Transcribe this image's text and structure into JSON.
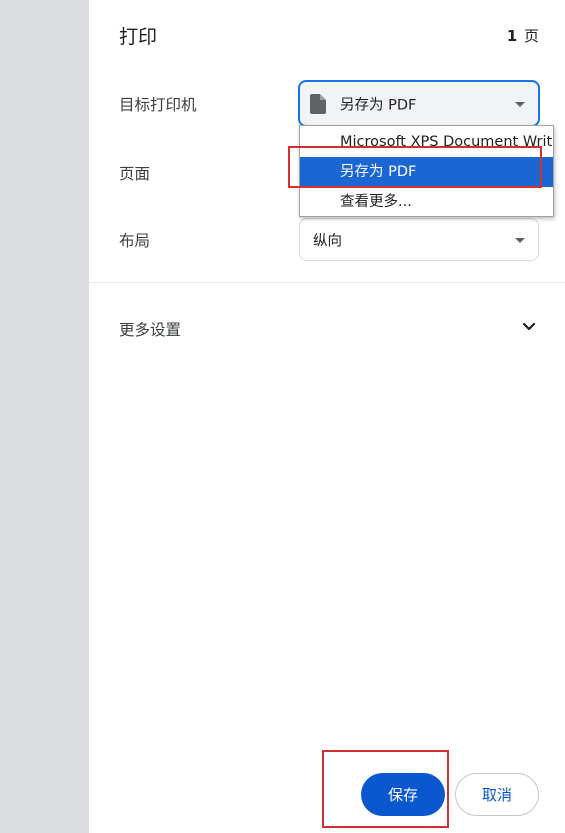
{
  "header": {
    "title": "打印",
    "page_count": "1",
    "page_unit": "页"
  },
  "rows": {
    "destination_label": "目标打印机",
    "destination_value": "另存为 PDF",
    "pages_label": "页面",
    "layout_label": "布局",
    "layout_value": "纵向"
  },
  "more_settings": {
    "label": "更多设置"
  },
  "dropdown": {
    "options": [
      "Microsoft XPS Document Writer",
      "另存为 PDF",
      "查看更多..."
    ],
    "selected": "另存为 PDF"
  },
  "actions": {
    "save_label": "保存",
    "cancel_label": "取消"
  },
  "colors": {
    "accent": "#1a73e8",
    "primary_button": "#0b57d0",
    "selected_option": "#1a66d2",
    "highlight_box": "#d32f2f",
    "left_strip": "#dadce0"
  }
}
